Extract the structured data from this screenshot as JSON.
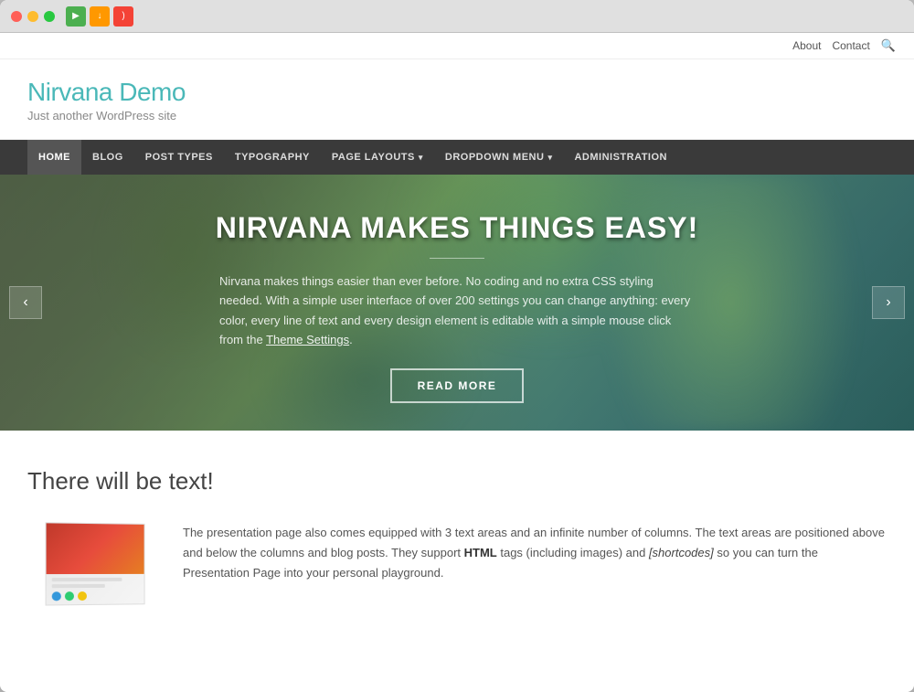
{
  "browser": {
    "dots": [
      "red",
      "yellow",
      "green"
    ]
  },
  "topnav": {
    "about": "About",
    "contact": "Contact",
    "search_icon": "🔍"
  },
  "siteheader": {
    "title": "Nirvana Demo",
    "tagline": "Just another WordPress site"
  },
  "mainnav": {
    "items": [
      {
        "label": "HOME",
        "active": true,
        "has_dropdown": false
      },
      {
        "label": "BLOG",
        "active": false,
        "has_dropdown": false
      },
      {
        "label": "POST TYPES",
        "active": false,
        "has_dropdown": false
      },
      {
        "label": "TYPOGRAPHY",
        "active": false,
        "has_dropdown": false
      },
      {
        "label": "PAGE LAYOUTS",
        "active": false,
        "has_dropdown": true
      },
      {
        "label": "DROPDOWN MENU",
        "active": false,
        "has_dropdown": true
      },
      {
        "label": "ADMINISTRATION",
        "active": false,
        "has_dropdown": false
      }
    ]
  },
  "hero": {
    "prev_label": "‹",
    "next_label": "›",
    "title": "NIRVANA MAKES THINGS EASY!",
    "description_part1": "Nirvana makes things easier than ever before. No coding and no extra CSS styling needed. With a simple user interface of over 200 settings you can change anything: every color, every line of text and every design element is editable with a simple mouse click from the ",
    "link_text": "Theme Settings",
    "description_part2": ".",
    "cta_label": "READ MORE"
  },
  "maincontent": {
    "heading": "There will be text!",
    "body_text_1": "The presentation page also comes equipped with 3 text areas and an infinite number of columns. The text areas are positioned above and below the columns and blog posts. They support ",
    "bold_text": "HTML",
    "body_text_2": " tags (including images) and ",
    "italic_text": "[shortcodes]",
    "body_text_3": " so you can turn the Presentation Page into your personal playground."
  }
}
